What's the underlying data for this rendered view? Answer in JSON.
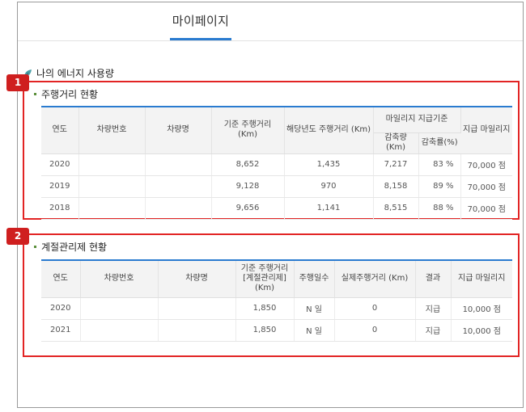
{
  "header": {
    "tab_label": "마이페이지"
  },
  "energy": {
    "title": "나의 에너지 사용량",
    "icon": "leaf-icon"
  },
  "callouts": [
    "1",
    "2"
  ],
  "colors": {
    "accent": "#2a7bd0",
    "highlight": "#e22424",
    "callout": "#cf1f1f"
  },
  "driving": {
    "title": "주행거리 현황",
    "headers": {
      "year": "연도",
      "plate": "차량번호",
      "car": "차량명",
      "base": "기준 주행거리 (Km)",
      "current": "해당년도 주행거리 (Km)",
      "group": "마일리지 지급기준",
      "reduce_amt": "감축량(Km)",
      "reduce_rate": "감축률(%)",
      "mileage": "지급 마일리지"
    },
    "rows": [
      {
        "year": "2020",
        "plate": "",
        "car": "",
        "base": "8,652",
        "current": "1,435",
        "reduce_amt": "7,217",
        "reduce_rate": "83 %",
        "mileage": "70,000 점"
      },
      {
        "year": "2019",
        "plate": "",
        "car": "",
        "base": "9,128",
        "current": "970",
        "reduce_amt": "8,158",
        "reduce_rate": "89 %",
        "mileage": "70,000 점"
      },
      {
        "year": "2018",
        "plate": "",
        "car": "",
        "base": "9,656",
        "current": "1,141",
        "reduce_amt": "8,515",
        "reduce_rate": "88 %",
        "mileage": "70,000 점"
      }
    ]
  },
  "seasonal": {
    "title": "계절관리제 현황",
    "headers": {
      "year": "연도",
      "plate": "차량번호",
      "car": "차량명",
      "base_line1": "기준 주행거리",
      "base_line2": "[계절관리제]",
      "base_line3": "(Km)",
      "days": "주행일수",
      "actual": "실제주행거리 (Km)",
      "result": "결과",
      "mileage": "지급 마일리지"
    },
    "rows": [
      {
        "year": "2020",
        "plate": "",
        "car": "",
        "base": "1,850",
        "days": "N 일",
        "actual": "0",
        "result": "지급",
        "mileage": "10,000 점"
      },
      {
        "year": "2021",
        "plate": "",
        "car": "",
        "base": "1,850",
        "days": "N 일",
        "actual": "0",
        "result": "지급",
        "mileage": "10,000 점"
      }
    ]
  }
}
